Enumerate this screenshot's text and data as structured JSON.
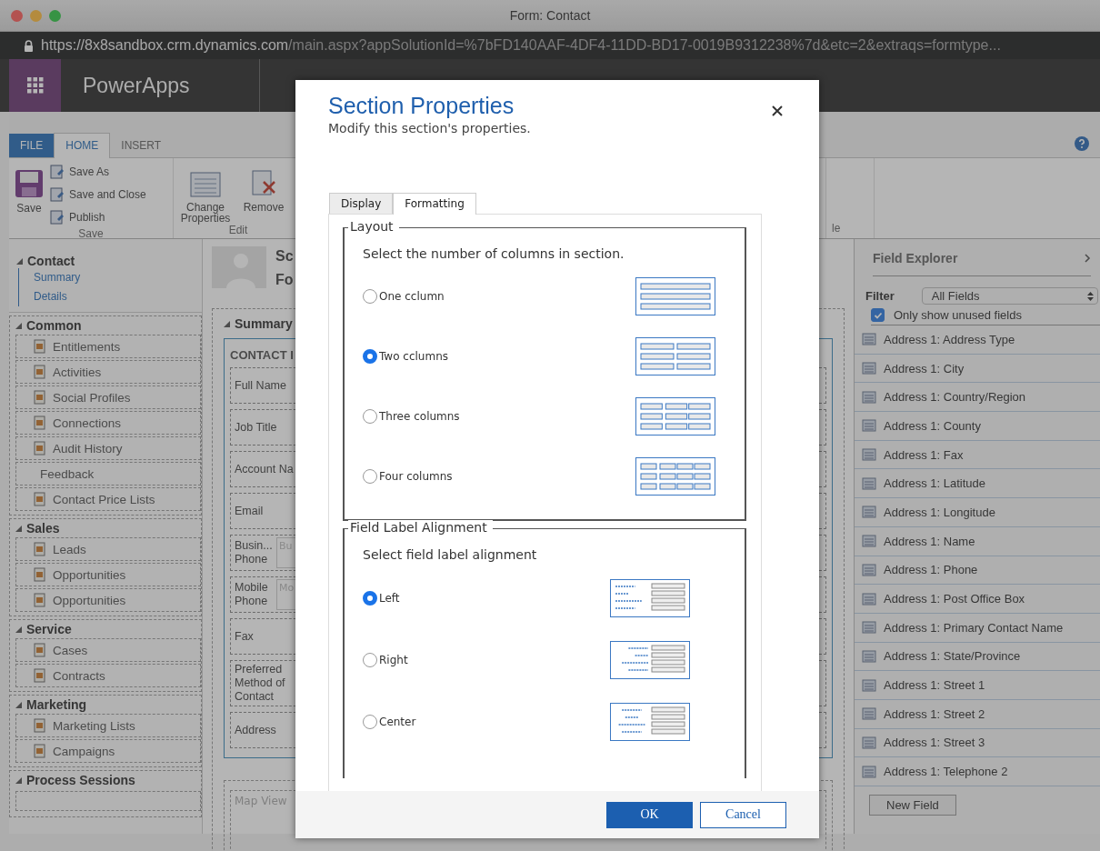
{
  "window": {
    "title": "Form: Contact"
  },
  "address_bar": {
    "host": "https://8x8sandbox.crm.dynamics.com",
    "path": "/main.aspx?appSolutionId=%7bFD140AAF-4DF4-11DD-BD17-0019B9312238%7d&etc=2&extraqs=formtype..."
  },
  "app_bar": {
    "title": "PowerApps"
  },
  "ribbon": {
    "tabs": [
      {
        "label": "FILE",
        "kind": "file",
        "selected": false
      },
      {
        "label": "HOME",
        "kind": "tab",
        "selected": true
      },
      {
        "label": "INSERT",
        "kind": "tab",
        "selected": false
      }
    ],
    "save_group": {
      "large_button": "Save",
      "small_buttons": [
        "Save As",
        "Save and Close",
        "Publish"
      ],
      "label": "Save"
    },
    "edit_group": {
      "buttons": [
        "Change Properties",
        "Remove"
      ],
      "label": "Edit"
    },
    "partial_group_label": "le"
  },
  "navigation": {
    "header": "Contact",
    "links": [
      "Summary",
      "Details"
    ],
    "sections": [
      {
        "title": "Common",
        "items": [
          {
            "label": "Entitlements",
            "kind": "icon"
          },
          {
            "label": "Activities",
            "kind": "icon"
          },
          {
            "label": "Social Profiles",
            "kind": "icon"
          },
          {
            "label": "Connections",
            "kind": "icon"
          },
          {
            "label": "Audit History",
            "kind": "icon"
          },
          {
            "label": "Feedback",
            "kind": "plain"
          },
          {
            "label": "Contact Price Lists",
            "kind": "icon"
          }
        ]
      },
      {
        "title": "Sales",
        "items": [
          {
            "label": "Leads",
            "kind": "icon"
          },
          {
            "label": "Opportunities",
            "kind": "icon"
          },
          {
            "label": "Opportunities",
            "kind": "icon"
          }
        ]
      },
      {
        "title": "Service",
        "items": [
          {
            "label": "Cases",
            "kind": "icon"
          },
          {
            "label": "Contracts",
            "kind": "icon"
          }
        ]
      },
      {
        "title": "Marketing",
        "items": [
          {
            "label": "Marketing Lists",
            "kind": "icon"
          },
          {
            "label": "Campaigns",
            "kind": "icon"
          }
        ]
      },
      {
        "title": "Process Sessions"
      }
    ]
  },
  "form": {
    "header_lines": [
      "Sc",
      "Fo"
    ],
    "tab_title": "Summary",
    "section_title": "CONTACT I",
    "fields": [
      {
        "label": "Full Name",
        "kind": "label"
      },
      {
        "label": "Job Title",
        "kind": "label"
      },
      {
        "label": "Account Na",
        "kind": "label"
      },
      {
        "label": "Email",
        "kind": "label"
      },
      {
        "label": "Busin... Phone",
        "kind": "input",
        "placeholder": "Bu"
      },
      {
        "label": "Mobile Phone",
        "kind": "input",
        "placeholder": "Mo"
      },
      {
        "label": "Fax",
        "kind": "label"
      },
      {
        "label": "Preferred Method of Contact",
        "kind": "label"
      },
      {
        "label": "Address",
        "kind": "label"
      }
    ],
    "map_placeholder": "Map View"
  },
  "field_explorer": {
    "title": "Field Explorer",
    "filter_label": "Filter",
    "filter_value": "All Fields",
    "unused_only": {
      "label": "Only show unused fields",
      "checked": true
    },
    "fields": [
      "Address 1: Address Type",
      "Address 1: City",
      "Address 1: Country/Region",
      "Address 1: County",
      "Address 1: Fax",
      "Address 1: Latitude",
      "Address 1: Longitude",
      "Address 1: Name",
      "Address 1: Phone",
      "Address 1: Post Office Box",
      "Address 1: Primary Contact Name",
      "Address 1: State/Province",
      "Address 1: Street 1",
      "Address 1: Street 2",
      "Address 1: Street 3",
      "Address 1: Telephone 2"
    ],
    "new_field_button": "New Field"
  },
  "dialog": {
    "title": "Section Properties",
    "subtitle": "Modify this section's properties.",
    "tabs": [
      {
        "label": "Display",
        "selected": false
      },
      {
        "label": "Formatting",
        "selected": true
      }
    ],
    "layout": {
      "legend": "Layout",
      "prompt": "Select the number of columns in section.",
      "options": [
        {
          "label": "One cclumn",
          "selected": false
        },
        {
          "label": "Two cclumns",
          "selected": true
        },
        {
          "label": "Three columns",
          "selected": false
        },
        {
          "label": "Four columns",
          "selected": false
        }
      ]
    },
    "alignment": {
      "legend": "Field Label Alignment",
      "prompt": "Select field label alignment",
      "options": [
        {
          "label": "Left",
          "selected": true
        },
        {
          "label": "Right",
          "selected": false
        },
        {
          "label": "Center",
          "selected": false
        }
      ]
    },
    "ok_button": "OK",
    "cancel_button": "Cancel"
  }
}
